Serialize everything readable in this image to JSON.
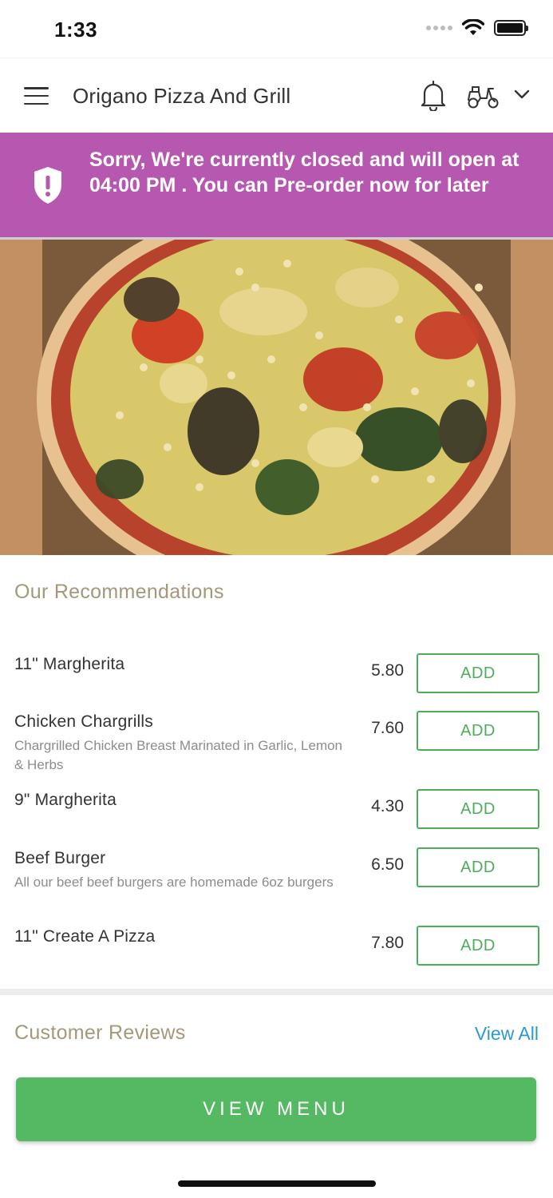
{
  "status_bar": {
    "time": "1:33"
  },
  "header": {
    "title": "Origano Pizza And Grill"
  },
  "banner": {
    "message": "Sorry, We're currently closed and will open at 04:00 PM . You can Pre-order now for later"
  },
  "recommendations": {
    "title": "Our Recommendations",
    "items": [
      {
        "name": "11\" Margherita",
        "description": "",
        "price": "5.80",
        "button": "ADD"
      },
      {
        "name": "Chicken Chargrills",
        "description": "Chargrilled Chicken Breast Marinated in Garlic, Lemon & Herbs",
        "price": "7.60",
        "button": "ADD"
      },
      {
        "name": "9\" Margherita",
        "description": "",
        "price": "4.30",
        "button": "ADD"
      },
      {
        "name": "Beef Burger",
        "description": "All our beef beef burgers are homemade 6oz burgers",
        "price": "6.50",
        "button": "ADD"
      },
      {
        "name": "11\" Create A Pizza",
        "description": "",
        "price": "7.80",
        "button": "ADD"
      }
    ]
  },
  "reviews": {
    "title": "Customer Reviews",
    "view_all": "View All"
  },
  "footer": {
    "view_menu": "VIEW MENU"
  },
  "colors": {
    "banner": "#b657b0",
    "accent_green": "#4cae5b",
    "button_green": "#55b862",
    "section_title": "#a5977a",
    "link_blue": "#2a9bcf"
  },
  "icons": [
    "hamburger-icon",
    "bell-icon",
    "scooter-icon",
    "chevron-down-icon",
    "shield-alert-icon"
  ]
}
